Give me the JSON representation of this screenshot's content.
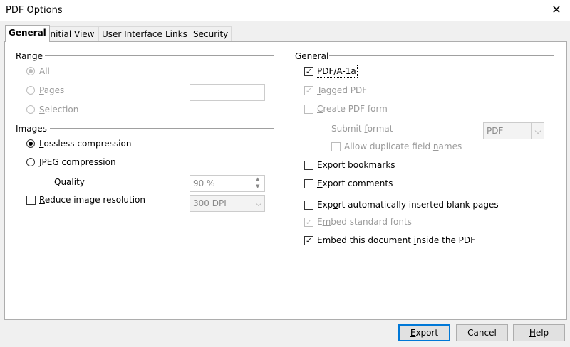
{
  "window": {
    "title": "PDF Options",
    "close_glyph": "✕"
  },
  "tabs": [
    {
      "label": "General",
      "active": true
    },
    {
      "label": "Initial View"
    },
    {
      "label": "User Interface"
    },
    {
      "label": "Links"
    },
    {
      "label": "Security"
    }
  ],
  "range": {
    "heading": "Range",
    "all": {
      "pre": "",
      "u": "A",
      "post": "ll"
    },
    "pages": {
      "pre": "",
      "u": "P",
      "post": "ages"
    },
    "selection": {
      "pre": "",
      "u": "S",
      "post": "election"
    },
    "pages_value": ""
  },
  "images": {
    "heading": "Images",
    "lossless": {
      "pre": "",
      "u": "L",
      "post": "ossless compression"
    },
    "jpeg": {
      "pre": "",
      "u": "J",
      "post": "PEG compression"
    },
    "quality_label": {
      "pre": "",
      "u": "Q",
      "post": "uality"
    },
    "quality_value": "90 %",
    "reduce": {
      "pre": "",
      "u": "R",
      "post": "educe image resolution"
    },
    "resolution_value": "300 DPI"
  },
  "general": {
    "heading": "General",
    "pdfa": {
      "pre": "",
      "u": "P",
      "post": "DF/A-1a"
    },
    "tagged": {
      "pre": "",
      "u": "T",
      "post": "agged PDF"
    },
    "create_form": {
      "pre": "",
      "u": "C",
      "post": "reate PDF form"
    },
    "submit_format_label": {
      "pre": "Submit ",
      "u": "f",
      "post": "ormat"
    },
    "submit_format_value": "PDF",
    "allow_dup": {
      "pre": "Allow duplicate field ",
      "u": "n",
      "post": "ames"
    },
    "export_bookmarks": {
      "pre": "Export ",
      "u": "b",
      "post": "ookmarks"
    },
    "export_comments": {
      "pre": "",
      "u": "E",
      "post": "xport comments"
    },
    "export_blank": {
      "pre": "Exp",
      "u": "o",
      "post": "rt automatically inserted blank pages"
    },
    "embed_fonts": {
      "pre": "E",
      "u": "m",
      "post": "bed standard fonts"
    },
    "embed_doc": {
      "pre": "Embed this document ",
      "u": "i",
      "post": "nside the PDF"
    }
  },
  "buttons": {
    "export": {
      "pre": "",
      "u": "E",
      "post": "xport"
    },
    "cancel": "Cancel",
    "help": {
      "pre": "",
      "u": "H",
      "post": "elp"
    }
  },
  "icons": {
    "check": "✓",
    "spin_up": "▲",
    "spin_down": "▼",
    "dropdown": "⌵"
  }
}
